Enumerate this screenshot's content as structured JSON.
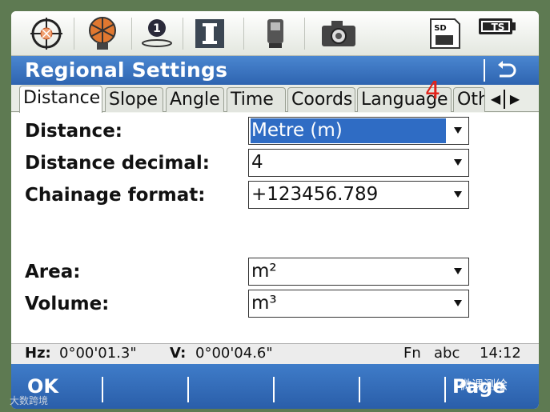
{
  "window": {
    "title": "Regional Settings"
  },
  "iconbar": {
    "icons": [
      "crosshair-target-icon",
      "prism-icon",
      "face-1-icon",
      "edm-mode-icon",
      "instrument-icon",
      "camera-icon",
      "sd-card-icon",
      "battery-icon"
    ],
    "face_number": "1",
    "sd_label": "SD",
    "battery_label": "TS"
  },
  "tabs": [
    {
      "label": "Distance",
      "active": true
    },
    {
      "label": "Slope",
      "active": false
    },
    {
      "label": "Angle",
      "active": false
    },
    {
      "label": "Time",
      "active": false
    },
    {
      "label": "Coords",
      "active": false
    },
    {
      "label": "Language",
      "active": false
    },
    {
      "label": "Oth",
      "active": false
    }
  ],
  "annotation": "4",
  "fields": [
    {
      "label": "Distance:",
      "value": "Metre (m)",
      "selected": true
    },
    {
      "label": "Distance decimal:",
      "value": "4",
      "selected": false
    },
    {
      "label": "Chainage format:",
      "value": "+123456.789",
      "selected": false
    },
    {
      "label": "Area:",
      "value": "m²",
      "selected": false
    },
    {
      "label": "Volume:",
      "value": "m³",
      "selected": false
    }
  ],
  "status": {
    "hz_label": "Hz:",
    "hz_value": "0°00'01.3\"",
    "v_label": "V:",
    "v_value": "0°00'04.6\"",
    "fn": "Fn",
    "input_mode": "abc",
    "time": "14:12"
  },
  "fkeys": {
    "f1": "OK",
    "f6": "Page"
  },
  "watermarks": {
    "left": "大数跨境",
    "right": "微课测绘"
  },
  "colors": {
    "title_bar": "#2e64b0",
    "selection": "#2f6cc4",
    "annotation": "#e2231a"
  }
}
